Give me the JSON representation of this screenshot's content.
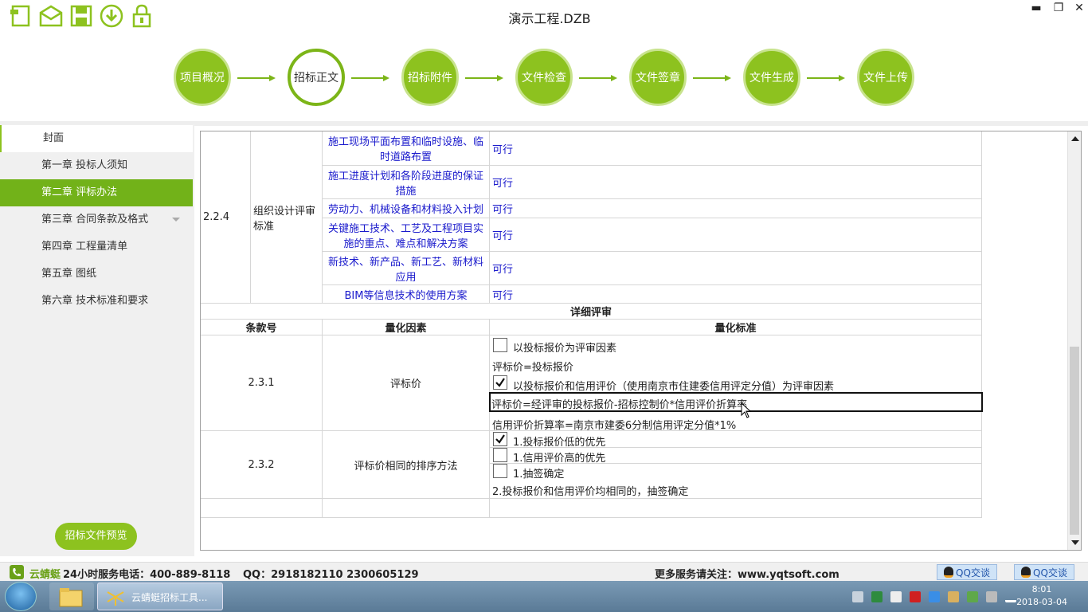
{
  "window": {
    "title": "演示工程.DZB",
    "minimize": "▬",
    "restore": "❐",
    "close": "✕"
  },
  "toolbar": {
    "icons": [
      "new-file-icon",
      "open-folder-icon",
      "save-icon",
      "download-icon",
      "lock-icon"
    ]
  },
  "steps": [
    {
      "label": "项目概况"
    },
    {
      "label": "招标正文",
      "active": true
    },
    {
      "label": "招标附件"
    },
    {
      "label": "文件检查"
    },
    {
      "label": "文件签章"
    },
    {
      "label": "文件生成"
    },
    {
      "label": "文件上传"
    }
  ],
  "sidebar": {
    "items": [
      {
        "label": "封面"
      },
      {
        "label": "第一章  投标人须知"
      },
      {
        "label": "第二章  评标办法",
        "active": true
      },
      {
        "label": "第三章  合同条款及格式"
      },
      {
        "label": "第四章  工程量清单"
      },
      {
        "label": "第五章  图纸"
      },
      {
        "label": "第六章  技术标准和要求"
      }
    ],
    "preview_button": "招标文件预览"
  },
  "table": {
    "section_224": {
      "clause": "2.2.4",
      "factor": "组织设计评审标准",
      "rows": [
        {
          "item": "施工现场平面布置和临时设施、临时道路布置",
          "standard": "可行"
        },
        {
          "item": "施工进度计划和各阶段进度的保证措施",
          "standard": "可行"
        },
        {
          "item": "劳动力、机械设备和材料投入计划",
          "standard": "可行"
        },
        {
          "item": "关键施工技术、工艺及工程项目实施的重点、难点和解决方案",
          "standard": "可行"
        },
        {
          "item": "新技术、新产品、新工艺、新材料应用",
          "standard": "可行"
        },
        {
          "item": "BIM等信息技术的使用方案",
          "standard": "可行"
        }
      ]
    },
    "detail_title": "详细评审",
    "headers": {
      "clause": "条款号",
      "factor": "量化因素",
      "standard": "量化标准"
    },
    "row_231": {
      "clause": "2.3.1",
      "factor": "评标价",
      "option1": "以投标报价为评审因素",
      "option1_checked": false,
      "formula1": "评标价=投标报价",
      "option2": "以投标报价和信用评价（使用南京市住建委信用评定分值）为评审因素",
      "option2_checked": true,
      "formula2": "评标价=经评审的投标报价-招标控制价*信用评价折算率",
      "formula3": "信用评价折算率=南京市建委6分制信用评定分值*1%"
    },
    "row_232": {
      "clause": "2.3.2",
      "factor": "评标价相同的排序方法",
      "rule1": "1.投标报价低的优先",
      "rule1_checked": true,
      "rule2": "1.信用评价高的优先",
      "rule2_checked": false,
      "rule3": "1.抽签确定",
      "rule3_checked": false,
      "rule4": "2.投标报价和信用评价均相同的，抽签确定"
    }
  },
  "statusbar": {
    "brand": "云蜻蜓",
    "hotline": "24小时服务电话：400-889-8118",
    "qq": "QQ：2918182110  2300605129",
    "website": "更多服务请关注：www.yqtsoft.com",
    "qq_btn": "QQ交谈"
  },
  "taskbar": {
    "app_label": "云蜻蜓招标工具...",
    "time": "8:01",
    "date": "2018-03-04"
  },
  "colors": {
    "accent_green": "#8dc21f",
    "active_nav": "#72b219",
    "link_blue": "#1a1acc"
  }
}
